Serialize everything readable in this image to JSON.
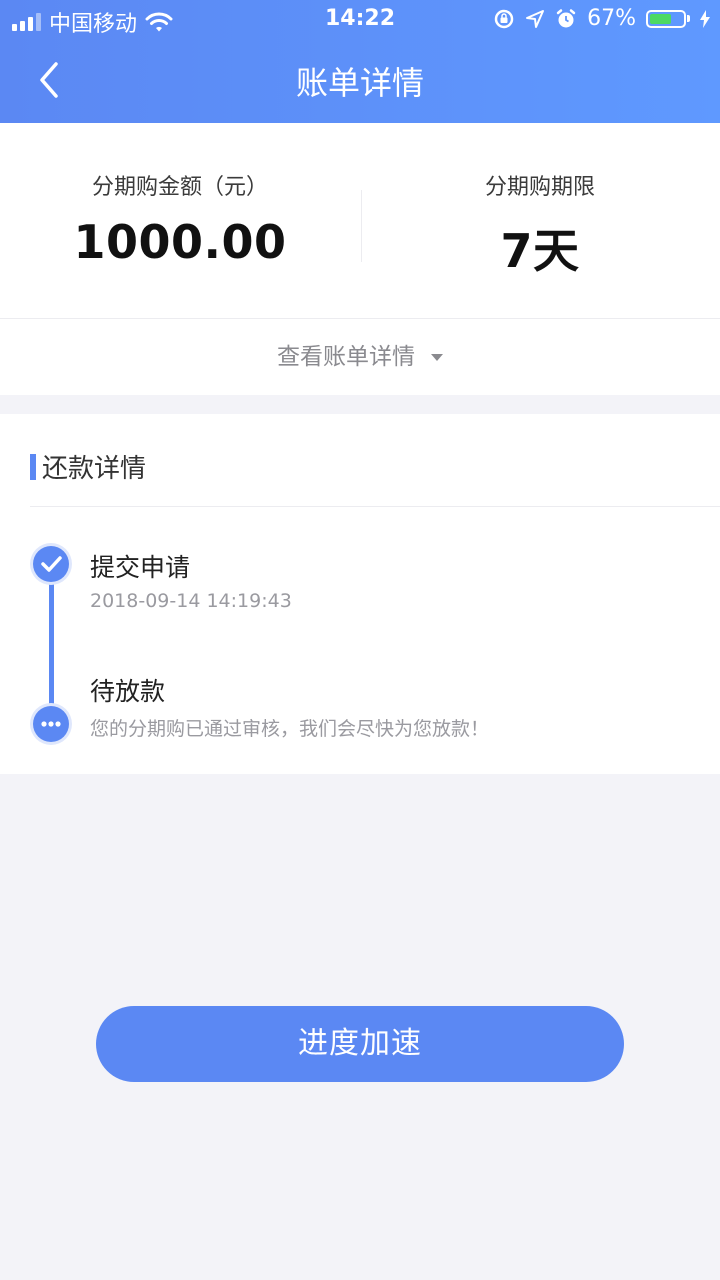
{
  "status_bar": {
    "carrier": "中国移动",
    "time": "14:22",
    "battery_percent": "67%",
    "battery_level": 0.67
  },
  "nav": {
    "title": "账单详情"
  },
  "summary": {
    "amount_label": "分期购金额（元）",
    "amount_value": "1000.00",
    "term_label": "分期购期限",
    "term_value": "7天"
  },
  "view_detail": {
    "label": "查看账单详情"
  },
  "repayment": {
    "section_title": "还款详情",
    "steps": [
      {
        "title": "提交申请",
        "subtitle": "2018-09-14 14:19:43",
        "status": "done"
      },
      {
        "title": "待放款",
        "subtitle": "您的分期购已通过审核，我们会尽快为您放款！",
        "status": "pending"
      }
    ]
  },
  "action": {
    "label": "进度加速"
  },
  "colors": {
    "accent": "#5b88f3",
    "background": "#f3f3f8"
  }
}
